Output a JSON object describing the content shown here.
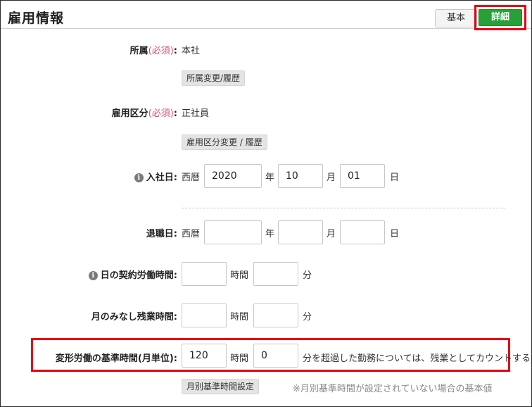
{
  "header": {
    "title": "雇用情報",
    "basic_label": "基本",
    "detail_label": "詳細"
  },
  "affiliation": {
    "label": "所属",
    "required": "(必須)",
    "colon": ":",
    "value": "本社",
    "button": "所属変更/履歴"
  },
  "employment_type": {
    "label": "雇用区分",
    "required": "(必須)",
    "colon": ":",
    "value": "正社員",
    "button": "雇用区分変更 / 履歴"
  },
  "hire_date": {
    "label": "入社日:",
    "era": "西暦",
    "year": "2020",
    "year_unit": "年",
    "month": "10",
    "month_unit": "月",
    "day": "01",
    "day_unit": "日"
  },
  "retire_date": {
    "label": "退職日:",
    "era": "西暦",
    "year": "",
    "year_unit": "年",
    "month": "",
    "month_unit": "月",
    "day": "",
    "day_unit": "日"
  },
  "daily_hours": {
    "label": "日の契約労働時間:",
    "hours": "",
    "hours_unit": "時間",
    "minutes": "",
    "minutes_unit": "分"
  },
  "monthly_overtime": {
    "label": "月のみなし残業時間:",
    "hours": "",
    "hours_unit": "時間",
    "minutes": "",
    "minutes_unit": "分"
  },
  "variable_hours": {
    "label": "変形労働の基準時間(月単位):",
    "hours": "120",
    "hours_unit": "時間",
    "minutes": "0",
    "minutes_unit": "分を超過した勤務については、残業としてカウントする",
    "button": "月別基準時間設定",
    "note": "※月別基準時間が設定されていない場合の基本値"
  }
}
